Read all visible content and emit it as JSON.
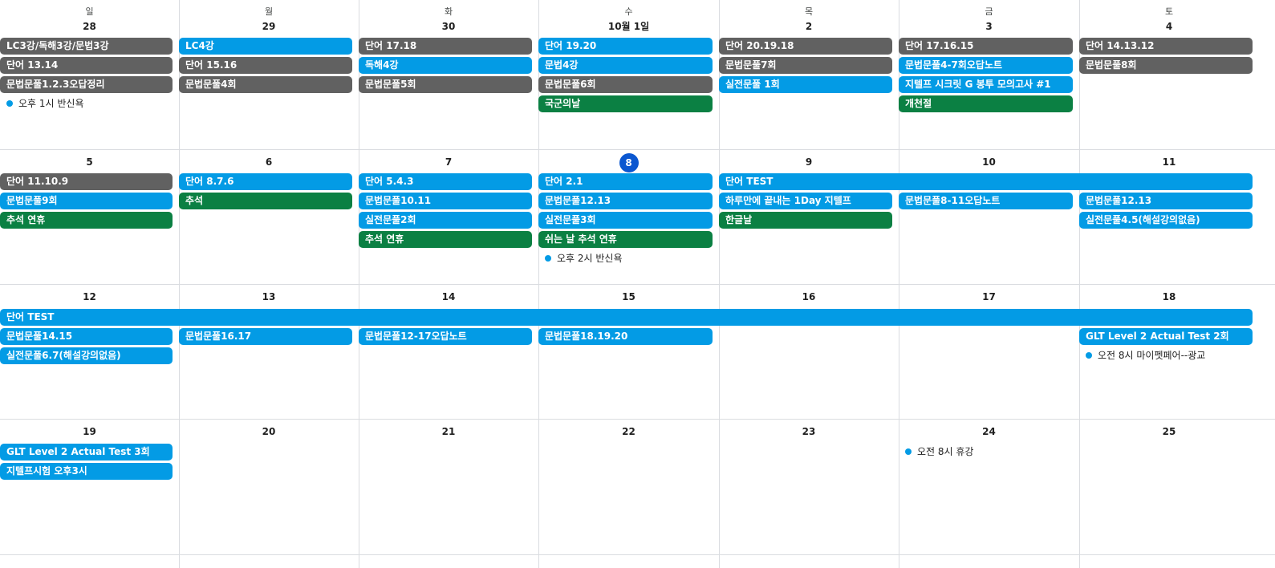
{
  "colors": {
    "blue": "#039be5",
    "gray": "#616161",
    "green": "#0b8043",
    "today": "#0b57d0",
    "grid": "#dadce0"
  },
  "weekdays": [
    "일",
    "월",
    "화",
    "수",
    "목",
    "금",
    "토"
  ],
  "weeks": [
    {
      "days": [
        "28",
        "29",
        "30",
        "10월 1일",
        "2",
        "3",
        "4"
      ],
      "events": [
        {
          "col": 0,
          "span": 1,
          "slot": 0,
          "text": "LC3강/독해3강/문법3강",
          "color": "gray"
        },
        {
          "col": 0,
          "span": 1,
          "slot": 1,
          "text": "단어 13.14",
          "color": "gray"
        },
        {
          "col": 0,
          "span": 1,
          "slot": 2,
          "text": "문법문풀1.2.3오답정리",
          "color": "gray"
        },
        {
          "col": 0,
          "span": 1,
          "slot": 3,
          "text": "오후 1시 반신욕",
          "color": "blue",
          "dot": true
        },
        {
          "col": 1,
          "span": 1,
          "slot": 0,
          "text": "LC4강",
          "color": "blue"
        },
        {
          "col": 1,
          "span": 1,
          "slot": 1,
          "text": "단어 15.16",
          "color": "gray"
        },
        {
          "col": 1,
          "span": 1,
          "slot": 2,
          "text": "문법문풀4회",
          "color": "gray"
        },
        {
          "col": 2,
          "span": 1,
          "slot": 0,
          "text": "단어 17.18",
          "color": "gray"
        },
        {
          "col": 2,
          "span": 1,
          "slot": 1,
          "text": "독해4강",
          "color": "blue"
        },
        {
          "col": 2,
          "span": 1,
          "slot": 2,
          "text": "문법문풀5회",
          "color": "gray"
        },
        {
          "col": 3,
          "span": 1,
          "slot": 0,
          "text": "단어 19.20",
          "color": "blue"
        },
        {
          "col": 3,
          "span": 1,
          "slot": 1,
          "text": "문법4강",
          "color": "blue"
        },
        {
          "col": 3,
          "span": 1,
          "slot": 2,
          "text": "문법문풀6회",
          "color": "gray"
        },
        {
          "col": 3,
          "span": 1,
          "slot": 3,
          "text": "국군의날",
          "color": "green"
        },
        {
          "col": 4,
          "span": 1,
          "slot": 0,
          "text": "단어 20.19.18",
          "color": "gray"
        },
        {
          "col": 4,
          "span": 1,
          "slot": 1,
          "text": "문법문풀7회",
          "color": "gray"
        },
        {
          "col": 4,
          "span": 1,
          "slot": 2,
          "text": "실전문풀 1회",
          "color": "blue"
        },
        {
          "col": 5,
          "span": 1,
          "slot": 0,
          "text": "단어 17.16.15",
          "color": "gray"
        },
        {
          "col": 5,
          "span": 1,
          "slot": 1,
          "text": "문법문풀4-7회오답노트",
          "color": "blue"
        },
        {
          "col": 5,
          "span": 1,
          "slot": 2,
          "text": "지텔프 시크릿 G 봉투 모의고사 #1",
          "color": "blue"
        },
        {
          "col": 5,
          "span": 1,
          "slot": 3,
          "text": "개천절",
          "color": "green"
        },
        {
          "col": 6,
          "span": 1,
          "slot": 0,
          "text": "단어 14.13.12",
          "color": "gray"
        },
        {
          "col": 6,
          "span": 1,
          "slot": 1,
          "text": "문법문풀8회",
          "color": "gray"
        }
      ]
    },
    {
      "days": [
        "5",
        "6",
        "7",
        "8",
        "9",
        "10",
        "11"
      ],
      "today_col": 3,
      "events": [
        {
          "col": 0,
          "span": 1,
          "slot": 0,
          "text": "단어 11.10.9",
          "color": "gray"
        },
        {
          "col": 0,
          "span": 1,
          "slot": 1,
          "text": "문법문풀9회",
          "color": "blue"
        },
        {
          "col": 0,
          "span": 1,
          "slot": 2,
          "text": "추석 연휴",
          "color": "green"
        },
        {
          "col": 1,
          "span": 1,
          "slot": 0,
          "text": "단어 8.7.6",
          "color": "blue"
        },
        {
          "col": 1,
          "span": 1,
          "slot": 1,
          "text": "추석",
          "color": "green"
        },
        {
          "col": 2,
          "span": 1,
          "slot": 0,
          "text": "단어 5.4.3",
          "color": "blue"
        },
        {
          "col": 2,
          "span": 1,
          "slot": 1,
          "text": "문법문풀10.11",
          "color": "blue"
        },
        {
          "col": 2,
          "span": 1,
          "slot": 2,
          "text": "실전문풀2회",
          "color": "blue"
        },
        {
          "col": 2,
          "span": 1,
          "slot": 3,
          "text": "추석 연휴",
          "color": "green"
        },
        {
          "col": 3,
          "span": 1,
          "slot": 0,
          "text": "단어 2.1",
          "color": "blue"
        },
        {
          "col": 3,
          "span": 1,
          "slot": 1,
          "text": "문법문풀12.13",
          "color": "blue"
        },
        {
          "col": 3,
          "span": 1,
          "slot": 2,
          "text": "실전문풀3회",
          "color": "blue"
        },
        {
          "col": 3,
          "span": 1,
          "slot": 3,
          "text": "쉬는 날 추석 연휴",
          "color": "green"
        },
        {
          "col": 3,
          "span": 1,
          "slot": 4,
          "text": "오후 2시 반신욕",
          "color": "blue",
          "dot": true
        },
        {
          "col": 4,
          "span": 3,
          "slot": 0,
          "text": "단어 TEST",
          "color": "blue"
        },
        {
          "col": 4,
          "span": 1,
          "slot": 1,
          "text": "하루만에 끝내는 1Day 지텔프",
          "color": "blue"
        },
        {
          "col": 4,
          "span": 1,
          "slot": 2,
          "text": "한글날",
          "color": "green"
        },
        {
          "col": 5,
          "span": 1,
          "slot": 1,
          "text": "문법문풀8-11오답노트",
          "color": "blue"
        },
        {
          "col": 6,
          "span": 1,
          "slot": 1,
          "text": "문법문풀12.13",
          "color": "blue"
        },
        {
          "col": 6,
          "span": 1,
          "slot": 2,
          "text": "실전문풀4.5(해설강의없음)",
          "color": "blue"
        }
      ]
    },
    {
      "days": [
        "12",
        "13",
        "14",
        "15",
        "16",
        "17",
        "18"
      ],
      "events": [
        {
          "col": 0,
          "span": 7,
          "slot": 0,
          "text": "단어 TEST",
          "color": "blue"
        },
        {
          "col": 0,
          "span": 1,
          "slot": 1,
          "text": "문법문풀14.15",
          "color": "blue"
        },
        {
          "col": 0,
          "span": 1,
          "slot": 2,
          "text": "실전문풀6.7(해설강의없음)",
          "color": "blue"
        },
        {
          "col": 1,
          "span": 1,
          "slot": 1,
          "text": "문법문풀16.17",
          "color": "blue"
        },
        {
          "col": 2,
          "span": 1,
          "slot": 1,
          "text": "문법문풀12-17오답노트",
          "color": "blue"
        },
        {
          "col": 3,
          "span": 1,
          "slot": 1,
          "text": "문법문풀18.19.20",
          "color": "blue"
        },
        {
          "col": 6,
          "span": 1,
          "slot": 1,
          "text": "GLT Level 2 Actual Test 2회",
          "color": "blue"
        },
        {
          "col": 6,
          "span": 1,
          "slot": 2,
          "text": "오전 8시 마이펫페어--광교",
          "color": "blue",
          "dot": true
        }
      ]
    },
    {
      "days": [
        "19",
        "20",
        "21",
        "22",
        "23",
        "24",
        "25"
      ],
      "events": [
        {
          "col": 0,
          "span": 1,
          "slot": 0,
          "text": "GLT Level 2 Actual Test 3회",
          "color": "blue"
        },
        {
          "col": 0,
          "span": 1,
          "slot": 1,
          "text": "지텔프시험 오후3시",
          "color": "blue"
        },
        {
          "col": 5,
          "span": 1,
          "slot": 0,
          "text": "오전 8시 휴강",
          "color": "blue",
          "dot": true
        }
      ]
    }
  ]
}
